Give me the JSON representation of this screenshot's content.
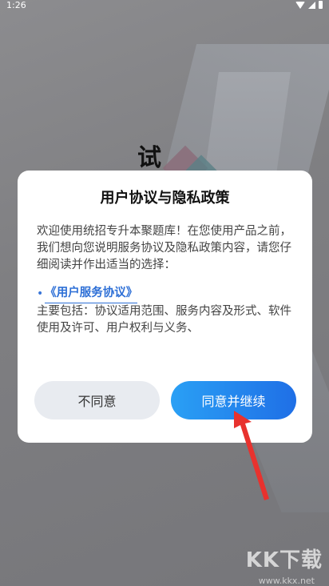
{
  "status_bar": {
    "time": "1:26"
  },
  "background": {
    "word": "试"
  },
  "dialog": {
    "title": "用户协议与隐私政策",
    "intro": "欢迎使用统招专升本聚题库！在您使用产品之前，我们想向您说明服务协议及隐私政策内容，请您仔细阅读并作出适当的选择：",
    "bullet": "•",
    "link_label": "《用户服务协议》",
    "summary": "主要包括：协议适用范围、服务内容及形式、软件使用及许可、用户权利与义务、",
    "disagree_label": "不同意",
    "agree_label": "同意并继续"
  },
  "watermark": {
    "text": "KK下载",
    "url": "www.kkx.net"
  },
  "colors": {
    "accent": "#1f6fe6",
    "arrow": "#e8322e"
  }
}
